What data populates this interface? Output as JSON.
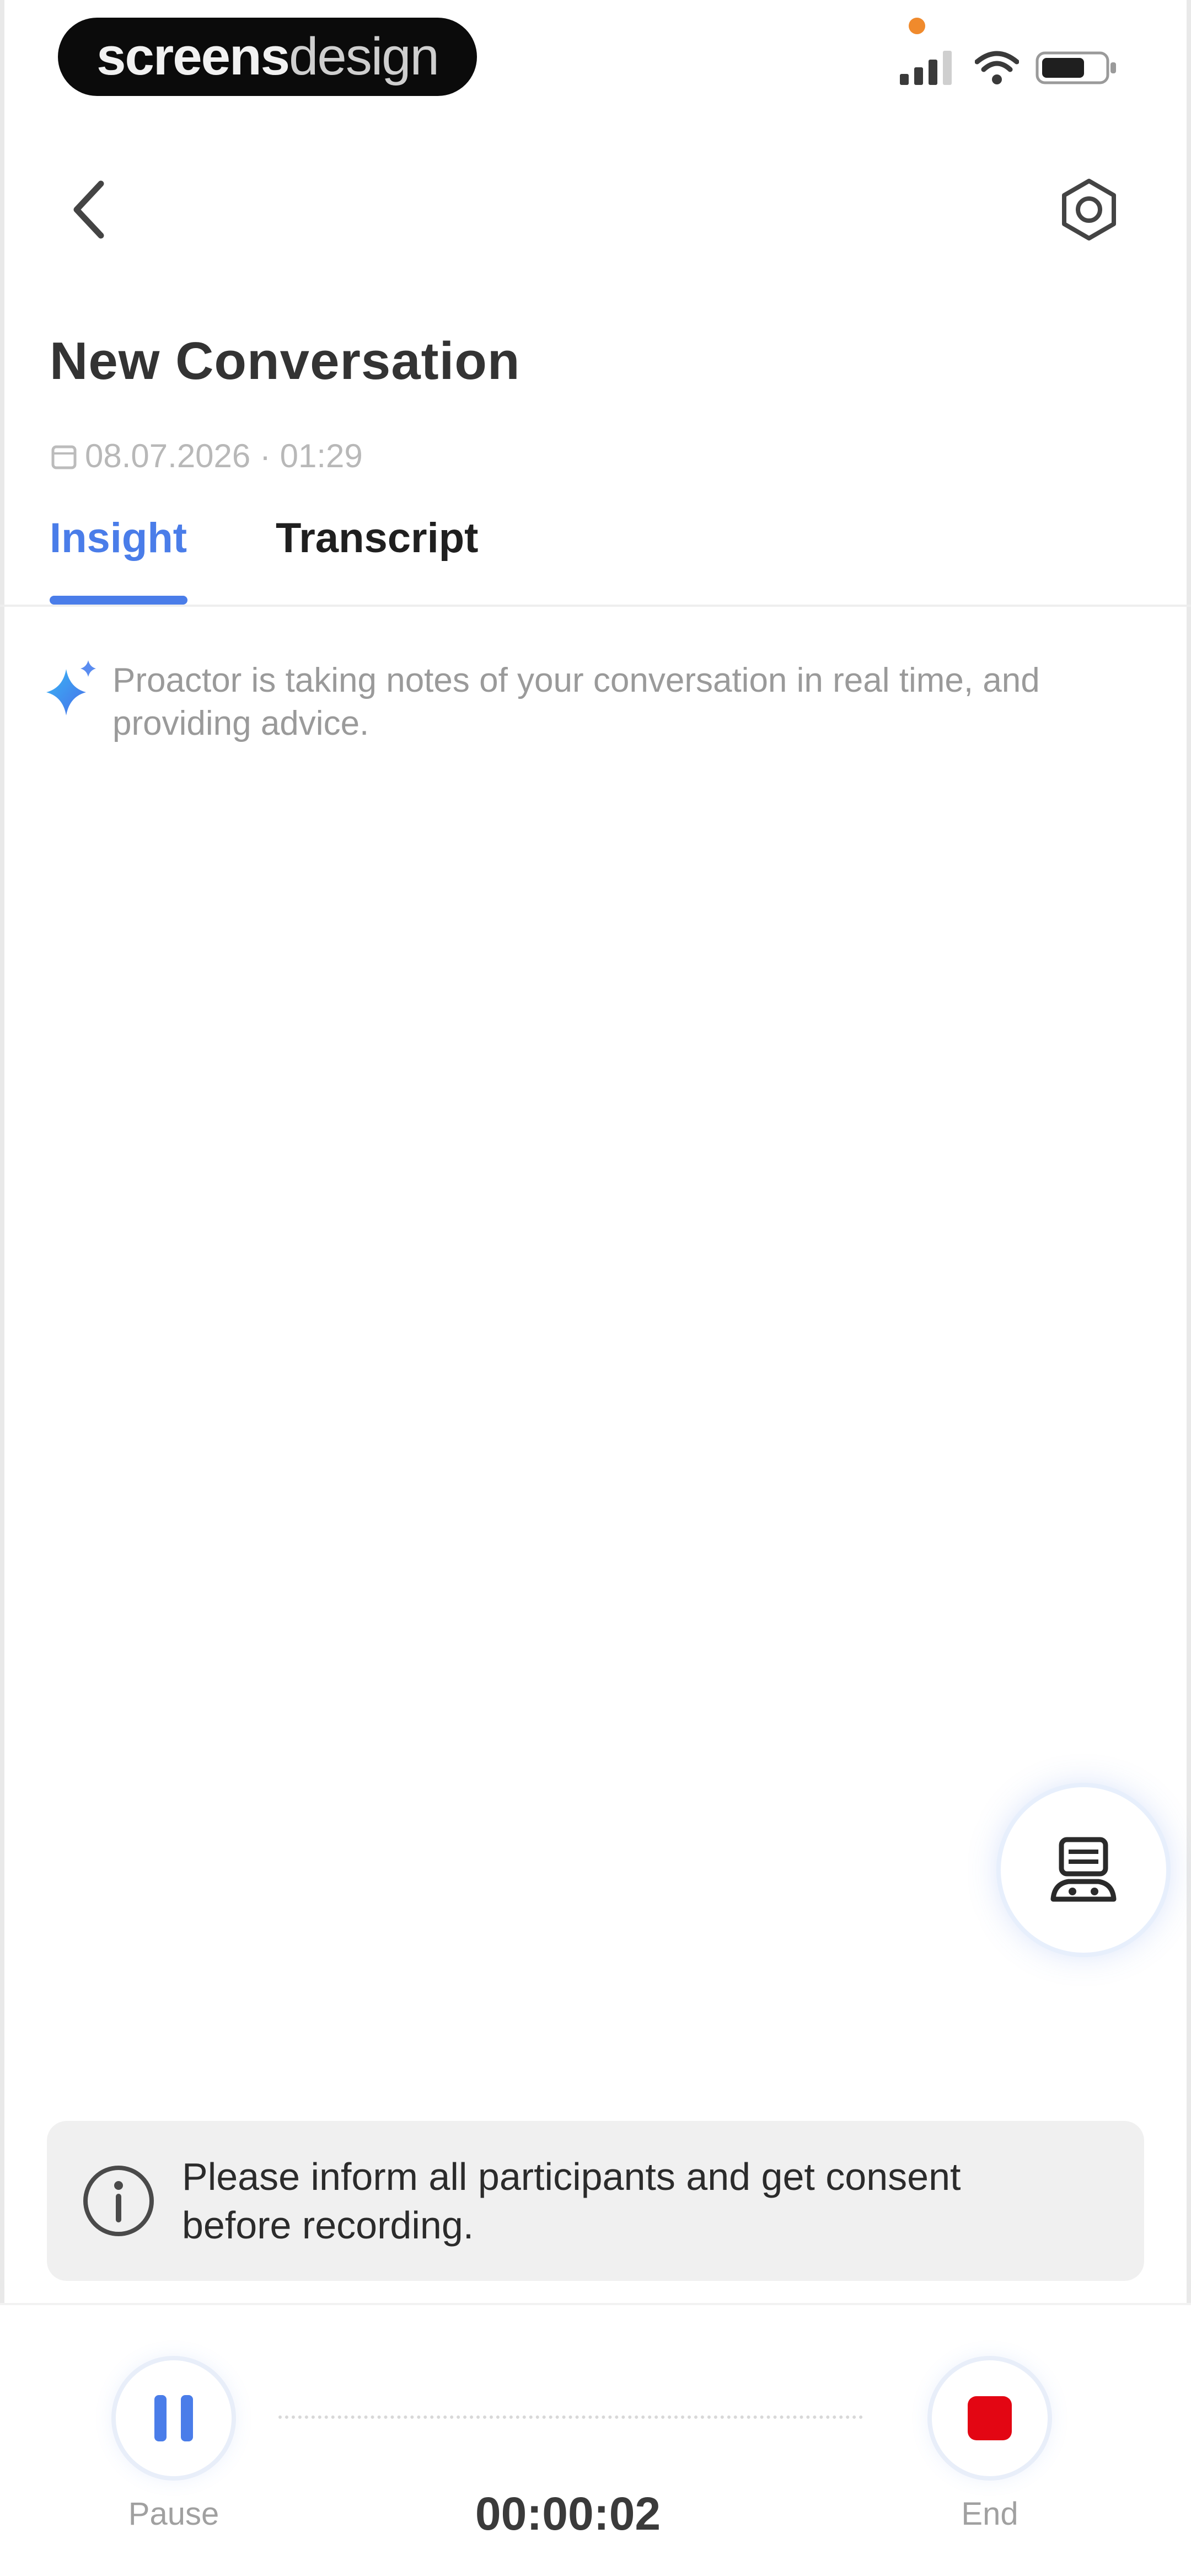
{
  "status_bar": {
    "brand_part1": "screens",
    "brand_part2": "design",
    "icons": [
      "cellular-signal-icon",
      "wifi-icon",
      "battery-icon"
    ]
  },
  "nav": {
    "back_icon": "chevron-left-icon",
    "settings_icon": "gear-icon"
  },
  "conversation": {
    "title": "New Conversation",
    "datetime": "08.07.2026 · 01:29",
    "calendar_icon": "calendar-icon"
  },
  "tabs": [
    {
      "label": "Insight",
      "active": true
    },
    {
      "label": "Transcript",
      "active": false
    }
  ],
  "ai_notice": {
    "icon": "sparkle-icon",
    "text": "Proactor is taking notes of your conversation in real time, and providing advice."
  },
  "fab": {
    "icon": "assistant-robot-icon"
  },
  "consent": {
    "icon": "info-icon",
    "text": "Please inform all participants and get consent before recording."
  },
  "controls": {
    "pause_label": "Pause",
    "end_label": "End",
    "timer": "00:00:02"
  },
  "colors": {
    "accent": "#4a7de9",
    "end": "#e30613",
    "status_dot": "#f08a2c"
  }
}
